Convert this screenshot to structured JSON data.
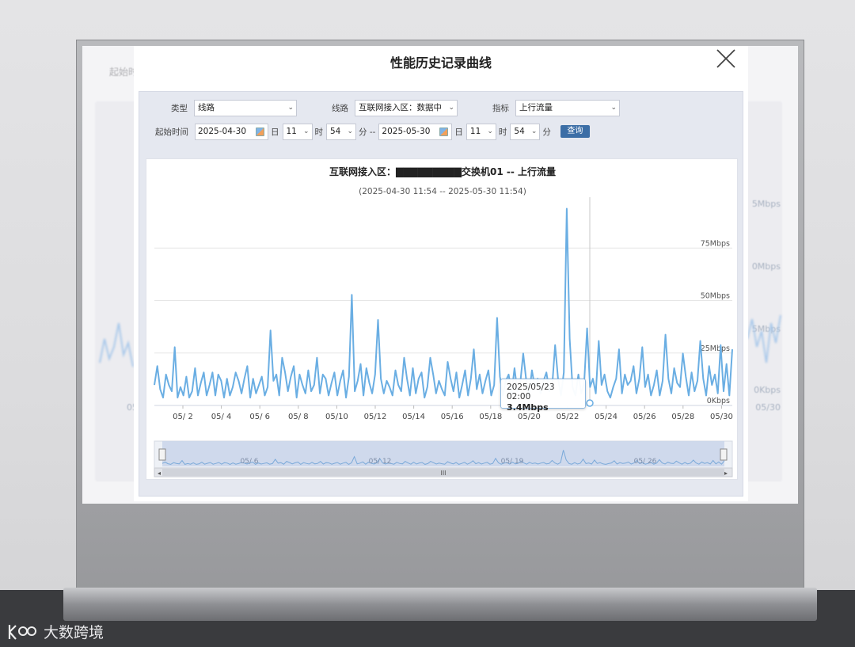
{
  "modal": {
    "title": "性能历史记录曲线",
    "close_label": "关闭"
  },
  "form": {
    "type_label": "类型",
    "type_value": "线路",
    "line_label": "线路",
    "line_value": "互联网接入区：数据中",
    "metric_label": "指标",
    "metric_value": "上行流量",
    "start_label": "起始时间",
    "start_date": "2025-04-30",
    "day_unit": "日",
    "start_hour": "11",
    "hour_unit": "时",
    "start_min": "54",
    "min_unit_sep": "分 --",
    "end_date": "2025-05-30",
    "end_day_unit": "日",
    "end_hour": "11",
    "end_hour_unit": "时",
    "end_min": "54",
    "end_min_unit": "分",
    "query_label": "查询"
  },
  "background": {
    "start_label": "起始时",
    "right_ticks": [
      "5Mbps",
      "0Mbps",
      "5Mbps",
      "0Kbps"
    ],
    "bottom_ticks": [
      "05/",
      "05/30"
    ]
  },
  "chart_data": {
    "type": "line",
    "title": "互联网接入区：▇▇▇▇▇▇▇▇▇交换机01 -- 上行流量",
    "subtitle": "(2025-04-30 11:54 -- 2025-05-30 11:54)",
    "x_tick_labels": [
      "05/ 2",
      "05/ 4",
      "05/ 6",
      "05/ 8",
      "05/10",
      "05/12",
      "05/14",
      "05/16",
      "05/18",
      "05/20",
      "05/22",
      "05/24",
      "05/26",
      "05/28",
      "05/30"
    ],
    "y_tick_labels": [
      "0Kbps",
      "25Mbps",
      "50Mbps",
      "75Mbps"
    ],
    "ylim": [
      0,
      100
    ],
    "y_unit": "Mbps",
    "grid": true,
    "series": [
      {
        "color": "#6aaee3",
        "values": [
          9,
          18,
          7,
          3,
          14,
          9,
          6,
          27,
          3,
          8,
          4,
          13,
          3,
          6,
          17,
          4,
          10,
          15,
          4,
          9,
          15,
          4,
          14,
          11,
          3,
          12,
          4,
          8,
          15,
          11,
          5,
          12,
          18,
          3,
          12,
          5,
          9,
          13,
          4,
          8,
          35,
          11,
          14,
          4,
          22,
          15,
          6,
          13,
          18,
          3,
          14,
          9,
          5,
          16,
          6,
          9,
          22,
          5,
          14,
          12,
          4,
          10,
          15,
          4,
          11,
          16,
          3,
          13,
          52,
          6,
          11,
          19,
          4,
          17,
          10,
          5,
          14,
          40,
          12,
          5,
          11,
          8,
          4,
          16,
          9,
          6,
          22,
          12,
          4,
          17,
          5,
          12,
          15,
          3,
          8,
          22,
          14,
          5,
          11,
          7,
          4,
          20,
          12,
          6,
          15,
          3,
          9,
          16,
          4,
          12,
          26,
          7,
          14,
          5,
          11,
          16,
          4,
          9,
          41,
          13,
          4,
          11,
          14,
          5,
          17,
          6,
          10,
          24,
          12,
          4,
          16,
          8,
          12,
          5,
          11,
          15,
          6,
          9,
          28,
          12,
          4,
          15,
          93,
          31,
          8,
          4,
          14,
          5,
          10,
          36,
          8,
          12,
          5,
          30,
          9,
          14,
          6,
          3,
          8,
          12,
          26,
          5,
          14,
          9,
          11,
          18,
          5,
          12,
          27,
          8,
          14,
          4,
          9,
          16,
          4,
          11,
          33,
          12,
          5,
          17,
          10,
          8,
          24,
          13,
          4,
          15,
          6,
          11,
          30,
          12,
          4,
          18,
          9,
          14,
          5,
          28,
          6,
          19,
          4,
          26
        ]
      }
    ],
    "tooltip": {
      "time": "2025/05/23 02:00",
      "value": "3.4Mbps"
    },
    "navigator_labels": [
      "05/ 6",
      "05/ 12",
      "05/ 19",
      "05/ 26"
    ],
    "navigator_scroll_label": "III"
  },
  "watermark": {
    "text": "大数跨境"
  }
}
